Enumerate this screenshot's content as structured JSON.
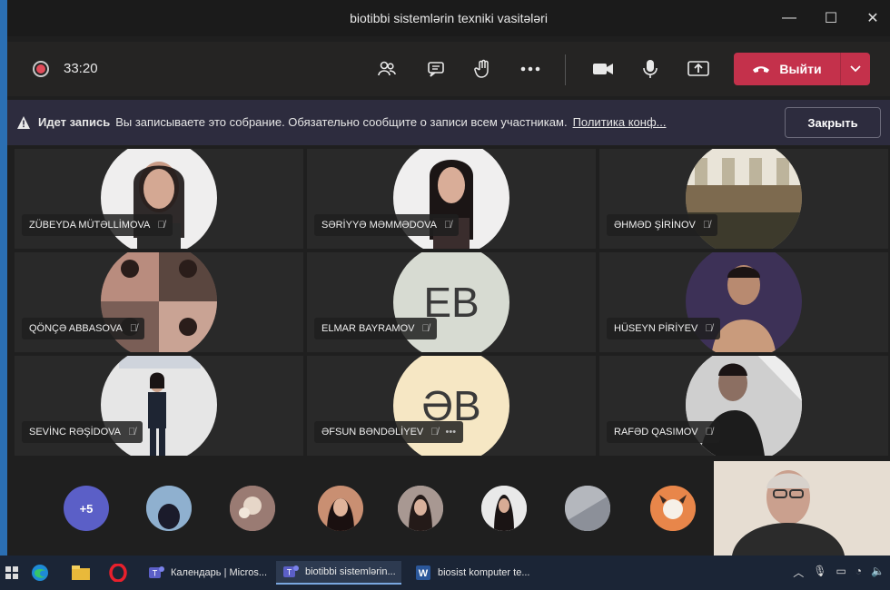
{
  "window": {
    "title": "biotibbi sistemlərin texniki vasitələri",
    "controls": {
      "minimize": "—",
      "maximize": "☐",
      "close": "✕"
    }
  },
  "toolbar": {
    "timer": "33:20",
    "leave_label": "Выйти",
    "accent": "#c4314b"
  },
  "banner": {
    "title": "Идет запись",
    "message": "Вы записываете это собрание. Обязательно сообщите о записи всем участникам.",
    "link": "Политика конф...",
    "close_label": "Закрыть"
  },
  "participants": [
    {
      "name": "ZÜBEYDA MÜTƏLLİMOVA",
      "type": "photo",
      "bg": "#efeeee"
    },
    {
      "name": "SƏRİYYƏ MƏMMƏDOVA",
      "type": "photo",
      "bg": "#f0efef"
    },
    {
      "name": "ƏHMƏD ŞİRİNOV",
      "type": "photo",
      "bg": "#8b8a74"
    },
    {
      "name": "QÖNÇƏ ABBASOVA",
      "type": "photo",
      "bg": "#6d5a55"
    },
    {
      "name": "ELMAR BAYRAMOV",
      "type": "initials",
      "initials": "EB",
      "bg": "#d7dbd2"
    },
    {
      "name": "HÜSEYN PİRİYEV",
      "type": "photo",
      "bg": "#3d3157"
    },
    {
      "name": "SEVİNC RƏŞİDOVA",
      "type": "photo",
      "bg": "#e6e6e6"
    },
    {
      "name": "ƏFSUN BƏNDƏLİYEV",
      "type": "initials",
      "initials": "ƏB",
      "bg": "#f6e7c4"
    },
    {
      "name": "RAFƏD QASIMOV",
      "type": "photo",
      "bg": "#d8d8d8"
    }
  ],
  "strip": {
    "more_count": "+5"
  },
  "taskbar": {
    "apps": [
      {
        "label": "Календарь | Micros..."
      },
      {
        "label": "biotibbi sistemlərin..."
      },
      {
        "label": "biosist komputer te..."
      }
    ]
  }
}
